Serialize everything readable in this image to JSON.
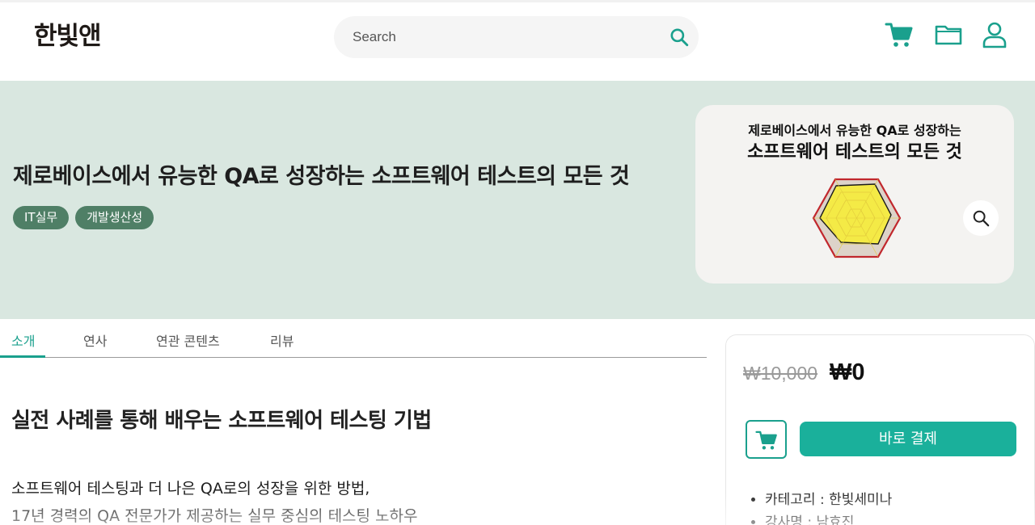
{
  "header": {
    "logo": "한빛앤",
    "search_placeholder": "Search",
    "icons": [
      "cart-icon",
      "folder-icon",
      "user-icon"
    ],
    "accent_color": "#1aa08d"
  },
  "hero": {
    "title": "제로베이스에서 유능한 QA로 성장하는 소프트웨어 테스트의 모든 것",
    "tags": [
      "IT실무",
      "개발생산성"
    ],
    "background_color": "#d9e7e0",
    "thumbnail": {
      "line1": "제로베이스에서 유능한 QA로 성장하는",
      "line2": "소프트웨어 테스트의 모든 것"
    },
    "zoom_icon": "search-icon"
  },
  "tabs": [
    {
      "label": "소개",
      "active": true
    },
    {
      "label": "연사",
      "active": false
    },
    {
      "label": "연관 콘텐츠",
      "active": false
    },
    {
      "label": "리뷰",
      "active": false
    }
  ],
  "main": {
    "section_title": "실전 사례를 통해 배우는 소프트웨어 테스팅 기법",
    "desc_line1": "소프트웨어 테스팅과 더 나은 QA로의 성장을 위한 방법,",
    "desc_line2": "17년 경력의 QA 전문가가 제공하는 실무 중심의 테스팅 노하우"
  },
  "purchase": {
    "original_price": "₩10,000",
    "price": "₩0",
    "pay_label": "바로 결제",
    "info": [
      "카테고리 : 한빛세미나",
      "강사명 : 남효진"
    ]
  }
}
